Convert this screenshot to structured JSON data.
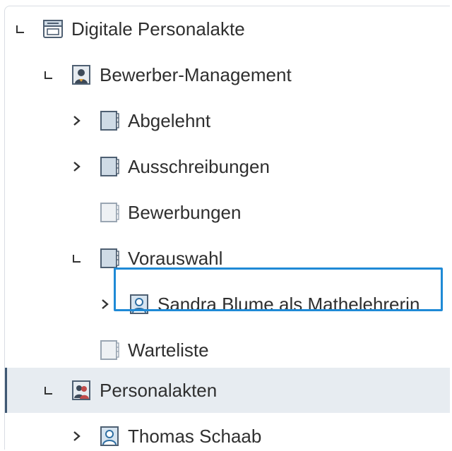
{
  "tree": {
    "items": [
      {
        "label": "Digitale Personalakte",
        "icon": "archive-icon",
        "state": "expanded"
      },
      {
        "label": "Bewerber-Management",
        "icon": "person-folder-icon",
        "state": "expanded"
      },
      {
        "label": "Abgelehnt",
        "icon": "register-icon",
        "state": "collapsed"
      },
      {
        "label": "Ausschreibungen",
        "icon": "register-icon",
        "state": "collapsed"
      },
      {
        "label": "Bewerbungen",
        "icon": "register-empty-icon",
        "state": "leaf"
      },
      {
        "label": "Vorauswahl",
        "icon": "register-icon",
        "state": "expanded"
      },
      {
        "label": "Sandra Blume als Mathelehrerin",
        "icon": "person-file-icon",
        "state": "collapsed",
        "focused": true
      },
      {
        "label": "Warteliste",
        "icon": "register-empty-icon",
        "state": "leaf"
      },
      {
        "label": "Personalakten",
        "icon": "person-folder-icon",
        "state": "expanded",
        "selected": true
      },
      {
        "label": "Thomas Schaab",
        "icon": "person-file-icon",
        "state": "collapsed"
      }
    ]
  },
  "colors": {
    "focus": "#1f8ad6",
    "selected_bg": "#e7ecf1",
    "register_fill": "#cfdbe6",
    "register_stroke": "#4e5f72"
  }
}
